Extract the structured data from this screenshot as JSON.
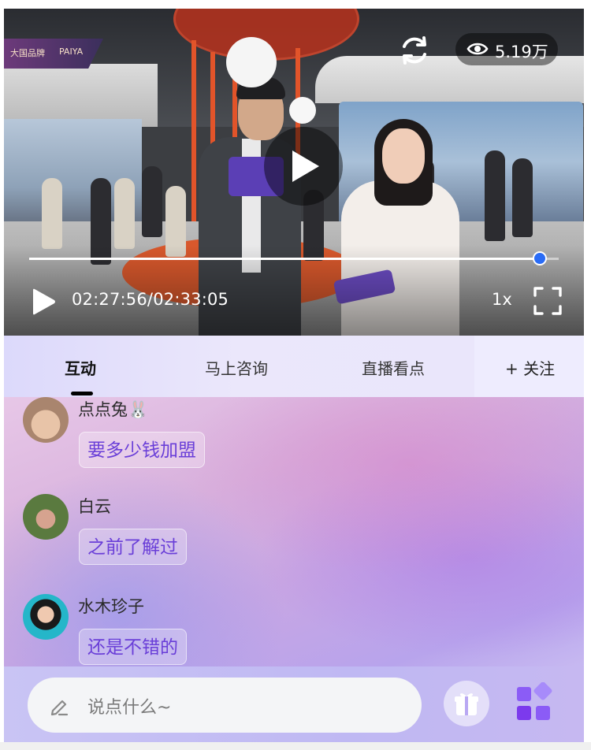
{
  "video": {
    "view_count": "5.19万",
    "current_time": "02:27:56",
    "duration": "02:33:05",
    "time_separator": "/",
    "progress": 0.965,
    "speed": "1x",
    "logo_text": "大国品牌",
    "logo_text_2": "PAIYA"
  },
  "tabs": {
    "items": [
      {
        "label": "互动",
        "active": true
      },
      {
        "label": "马上咨询",
        "active": false
      },
      {
        "label": "直播看点",
        "active": false
      }
    ],
    "follow_label": "+ 关注"
  },
  "chat": {
    "messages": [
      {
        "user": "点点兔🐰",
        "text": "要多少钱加盟",
        "avatar_color": "#c9a78d"
      },
      {
        "user": "白云",
        "text": "之前了解过",
        "avatar_color": "#6b8a4e"
      },
      {
        "user": "水木珍子",
        "text": "还是不错的",
        "avatar_color": "#1fb3c7"
      }
    ]
  },
  "input": {
    "placeholder": "说点什么~"
  },
  "colors": {
    "accent_blue": "#2a6cf6",
    "bubble_text": "#6a3fd8",
    "tab_bg": "#e9e6fb"
  },
  "icons": {
    "refresh": "refresh-icon",
    "views": "eye-icon",
    "play": "play-icon",
    "fullscreen": "fullscreen-icon",
    "edit": "pencil-icon",
    "gift": "gift-icon",
    "more": "apps-icon"
  }
}
